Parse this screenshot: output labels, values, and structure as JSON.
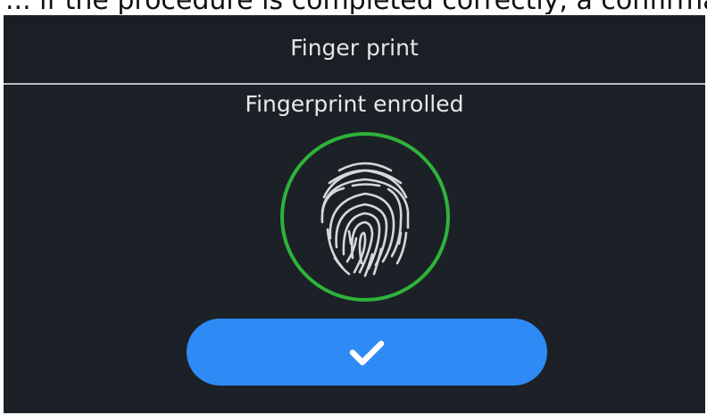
{
  "caption": "... if the procedure is completed correctly, a confirmation ...",
  "header": {
    "title": "Finger print"
  },
  "main": {
    "status": "Fingerprint enrolled",
    "fingerprint_icon": "fingerprint-icon",
    "ring_color": "#2eb33a"
  },
  "actions": {
    "confirm_icon": "check-icon",
    "confirm_color": "#2e8bf5"
  }
}
